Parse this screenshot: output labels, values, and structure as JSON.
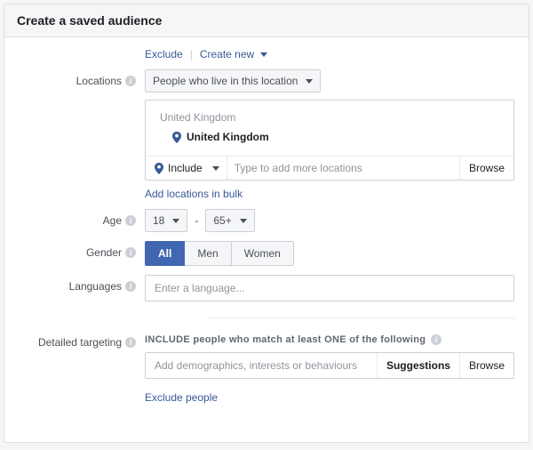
{
  "header": {
    "title": "Create a saved audience"
  },
  "top": {
    "exclude": "Exclude",
    "create_new": "Create new"
  },
  "labels": {
    "locations": "Locations",
    "age": "Age",
    "gender": "Gender",
    "languages": "Languages",
    "detailed_targeting": "Detailed targeting"
  },
  "locations": {
    "dropdown_label": "People who live in this location",
    "parent": "United Kingdom",
    "selected": "United Kingdom",
    "include_label": "Include",
    "input_placeholder": "Type to add more locations",
    "browse": "Browse",
    "add_bulk": "Add locations in bulk"
  },
  "age": {
    "min": "18",
    "max": "65+"
  },
  "gender": {
    "all": "All",
    "men": "Men",
    "women": "Women",
    "selected": "all"
  },
  "languages": {
    "placeholder": "Enter a language..."
  },
  "detailed": {
    "heading": "INCLUDE people who match at least ONE of the following",
    "placeholder": "Add demographics, interests or behaviours",
    "suggestions": "Suggestions",
    "browse": "Browse",
    "exclude_people": "Exclude people"
  }
}
